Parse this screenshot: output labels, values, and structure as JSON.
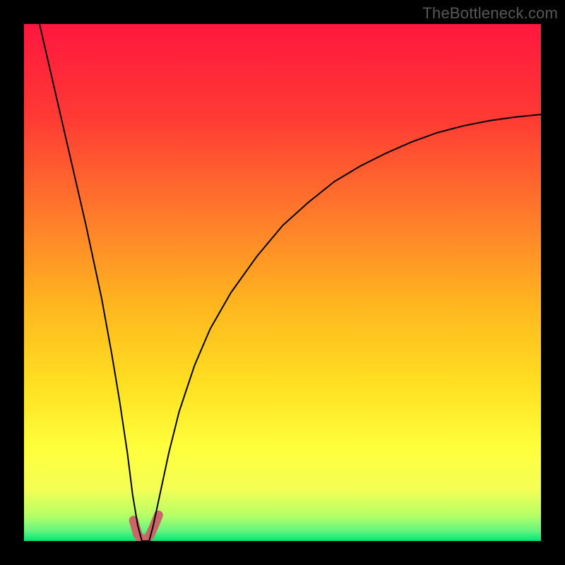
{
  "watermark": "TheBottleneck.com",
  "chart_data": {
    "type": "line",
    "title": "",
    "xlabel": "",
    "ylabel": "",
    "xlim": [
      0,
      100
    ],
    "ylim": [
      0,
      100
    ],
    "grid": false,
    "legend": false,
    "background_gradient": {
      "top": "#ff1744",
      "mid_upper": "#ff6e30",
      "mid": "#ffd400",
      "mid_lower": "#ffff4d",
      "lower": "#d6ff66",
      "bottom": "#00e676"
    },
    "series": [
      {
        "name": "bottleneck-curve",
        "color": "#000000",
        "stroke_width": 2,
        "x": [
          3,
          6,
          9,
          12,
          15,
          17,
          18.5,
          20,
          21,
          22,
          22.8,
          23.5,
          24.2,
          25,
          26.5,
          28,
          30,
          33,
          36,
          40,
          45,
          50,
          55,
          60,
          65,
          70,
          75,
          80,
          85,
          90,
          95,
          100
        ],
        "y": [
          100,
          87,
          74,
          61,
          47,
          36,
          27,
          17,
          9,
          3,
          0,
          0,
          0,
          3,
          10,
          17,
          25,
          34,
          41,
          48,
          55,
          61,
          65.5,
          69.5,
          72.5,
          75,
          77.2,
          79,
          80.3,
          81.3,
          82,
          82.5
        ]
      },
      {
        "name": "minimum-highlight",
        "color": "#cc6666",
        "stroke_width": 13,
        "linecap": "round",
        "x": [
          21.2,
          22.0,
          22.8,
          23.6,
          24.4,
          25.2,
          26.0
        ],
        "y": [
          4.0,
          1.2,
          0.2,
          0.2,
          1.2,
          3.0,
          5.0
        ]
      }
    ]
  }
}
